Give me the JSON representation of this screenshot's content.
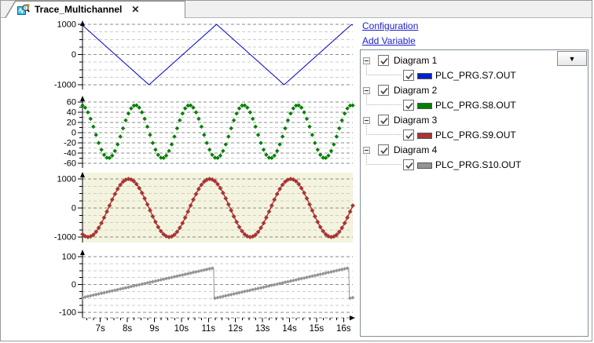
{
  "tab": {
    "title": "Trace_Multichannel",
    "close_label": "✕"
  },
  "panel": {
    "configuration_label": "Configuration",
    "add_variable_label": "Add Variable",
    "dropdown_glyph": "▼"
  },
  "legend": {
    "groups": [
      {
        "label": "Diagram 1",
        "checked": true,
        "child": {
          "label": "PLC_PRG.S7.OUT",
          "checked": true,
          "color": "#0022cc"
        }
      },
      {
        "label": "Diagram 2",
        "checked": true,
        "child": {
          "label": "PLC_PRG.S8.OUT",
          "checked": true,
          "color": "#008000"
        }
      },
      {
        "label": "Diagram 3",
        "checked": true,
        "child": {
          "label": "PLC_PRG.S9.OUT",
          "checked": true,
          "color": "#a93535"
        }
      },
      {
        "label": "Diagram 4",
        "checked": true,
        "child": {
          "label": "PLC_PRG.S10.OUT",
          "checked": true,
          "color": "#949494"
        }
      }
    ]
  },
  "chart_data": {
    "type": "line",
    "x_axis": {
      "start_s": 6.34,
      "end_s": 16.34,
      "tick_values": [
        7,
        8,
        9,
        10,
        11,
        12,
        13,
        14,
        15,
        16
      ],
      "tick_labels": [
        "7s",
        "8s",
        "9s",
        "10s",
        "11s",
        "12s",
        "13s",
        "14s",
        "15s",
        "16s"
      ],
      "minor_tick_s": 0.25,
      "grid": "horizontal-dashed-only"
    },
    "sample_interval_s": 0.1,
    "diagrams": [
      {
        "title": "Diagram 1",
        "series": "PLC_PRG.S7.OUT",
        "color": "#0000cc",
        "background": "#ffffff",
        "line": true,
        "markers": false,
        "marker_size": 0,
        "wave": {
          "kind": "triangle",
          "amplitude": 1000,
          "offset": 0,
          "period_s": 5,
          "peak_at_s": 11.3
        },
        "y_axis": {
          "min": -1150,
          "max": 1150,
          "major_step": 1000,
          "minor_step": 250,
          "labels": [
            {
              "value": 1000,
              "text": "1000"
            },
            {
              "value": 0,
              "text": "0"
            },
            {
              "value": -1000,
              "text": "-1000"
            }
          ]
        }
      },
      {
        "title": "Diagram 2",
        "series": "PLC_PRG.S8.OUT",
        "color": "#008000",
        "background": "#ffffff",
        "line": false,
        "markers": true,
        "marker_size": 2.3,
        "wave": {
          "kind": "sine",
          "amplitude": 52,
          "offset": 2,
          "period_s": 2,
          "peak_at_s": 8.3
        },
        "y_axis": {
          "min": -68,
          "max": 68,
          "major_step": 20,
          "minor_step": 10,
          "labels": [
            {
              "value": 60,
              "text": "60"
            },
            {
              "value": 40,
              "text": "40"
            },
            {
              "value": 20,
              "text": "20"
            },
            {
              "value": 0,
              "text": "0"
            },
            {
              "value": -20,
              "text": "-20"
            },
            {
              "value": -40,
              "text": "-40"
            },
            {
              "value": -60,
              "text": "-60"
            }
          ]
        }
      },
      {
        "title": "Diagram 3",
        "series": "PLC_PRG.S9.OUT",
        "color": "#a93535",
        "background": "#f4f4de",
        "line": true,
        "markers": true,
        "marker_size": 2.5,
        "wave": {
          "kind": "sine",
          "amplitude": 1000,
          "offset": 0,
          "period_s": 3,
          "peak_at_s": 8.05
        },
        "y_axis": {
          "min": -1180,
          "max": 1180,
          "major_step": 1000,
          "minor_step": 250,
          "labels": [
            {
              "value": 1000,
              "text": "1000"
            },
            {
              "value": 0,
              "text": "0"
            },
            {
              "value": -1000,
              "text": "-1000"
            }
          ]
        }
      },
      {
        "title": "Diagram 4",
        "series": "PLC_PRG.S10.OUT",
        "color": "#949494",
        "background": "#ffffff",
        "line": true,
        "markers": true,
        "marker_size": 2.0,
        "wave": {
          "kind": "sawtooth",
          "min": -50,
          "max": 60,
          "period_s": 5,
          "reset_at_s": 11.2
        },
        "y_axis": {
          "min": -115,
          "max": 115,
          "major_step": 100,
          "minor_step": 25,
          "labels": [
            {
              "value": 100,
              "text": "100"
            },
            {
              "value": 0,
              "text": "0"
            },
            {
              "value": -100,
              "text": "-100"
            }
          ]
        }
      }
    ]
  }
}
